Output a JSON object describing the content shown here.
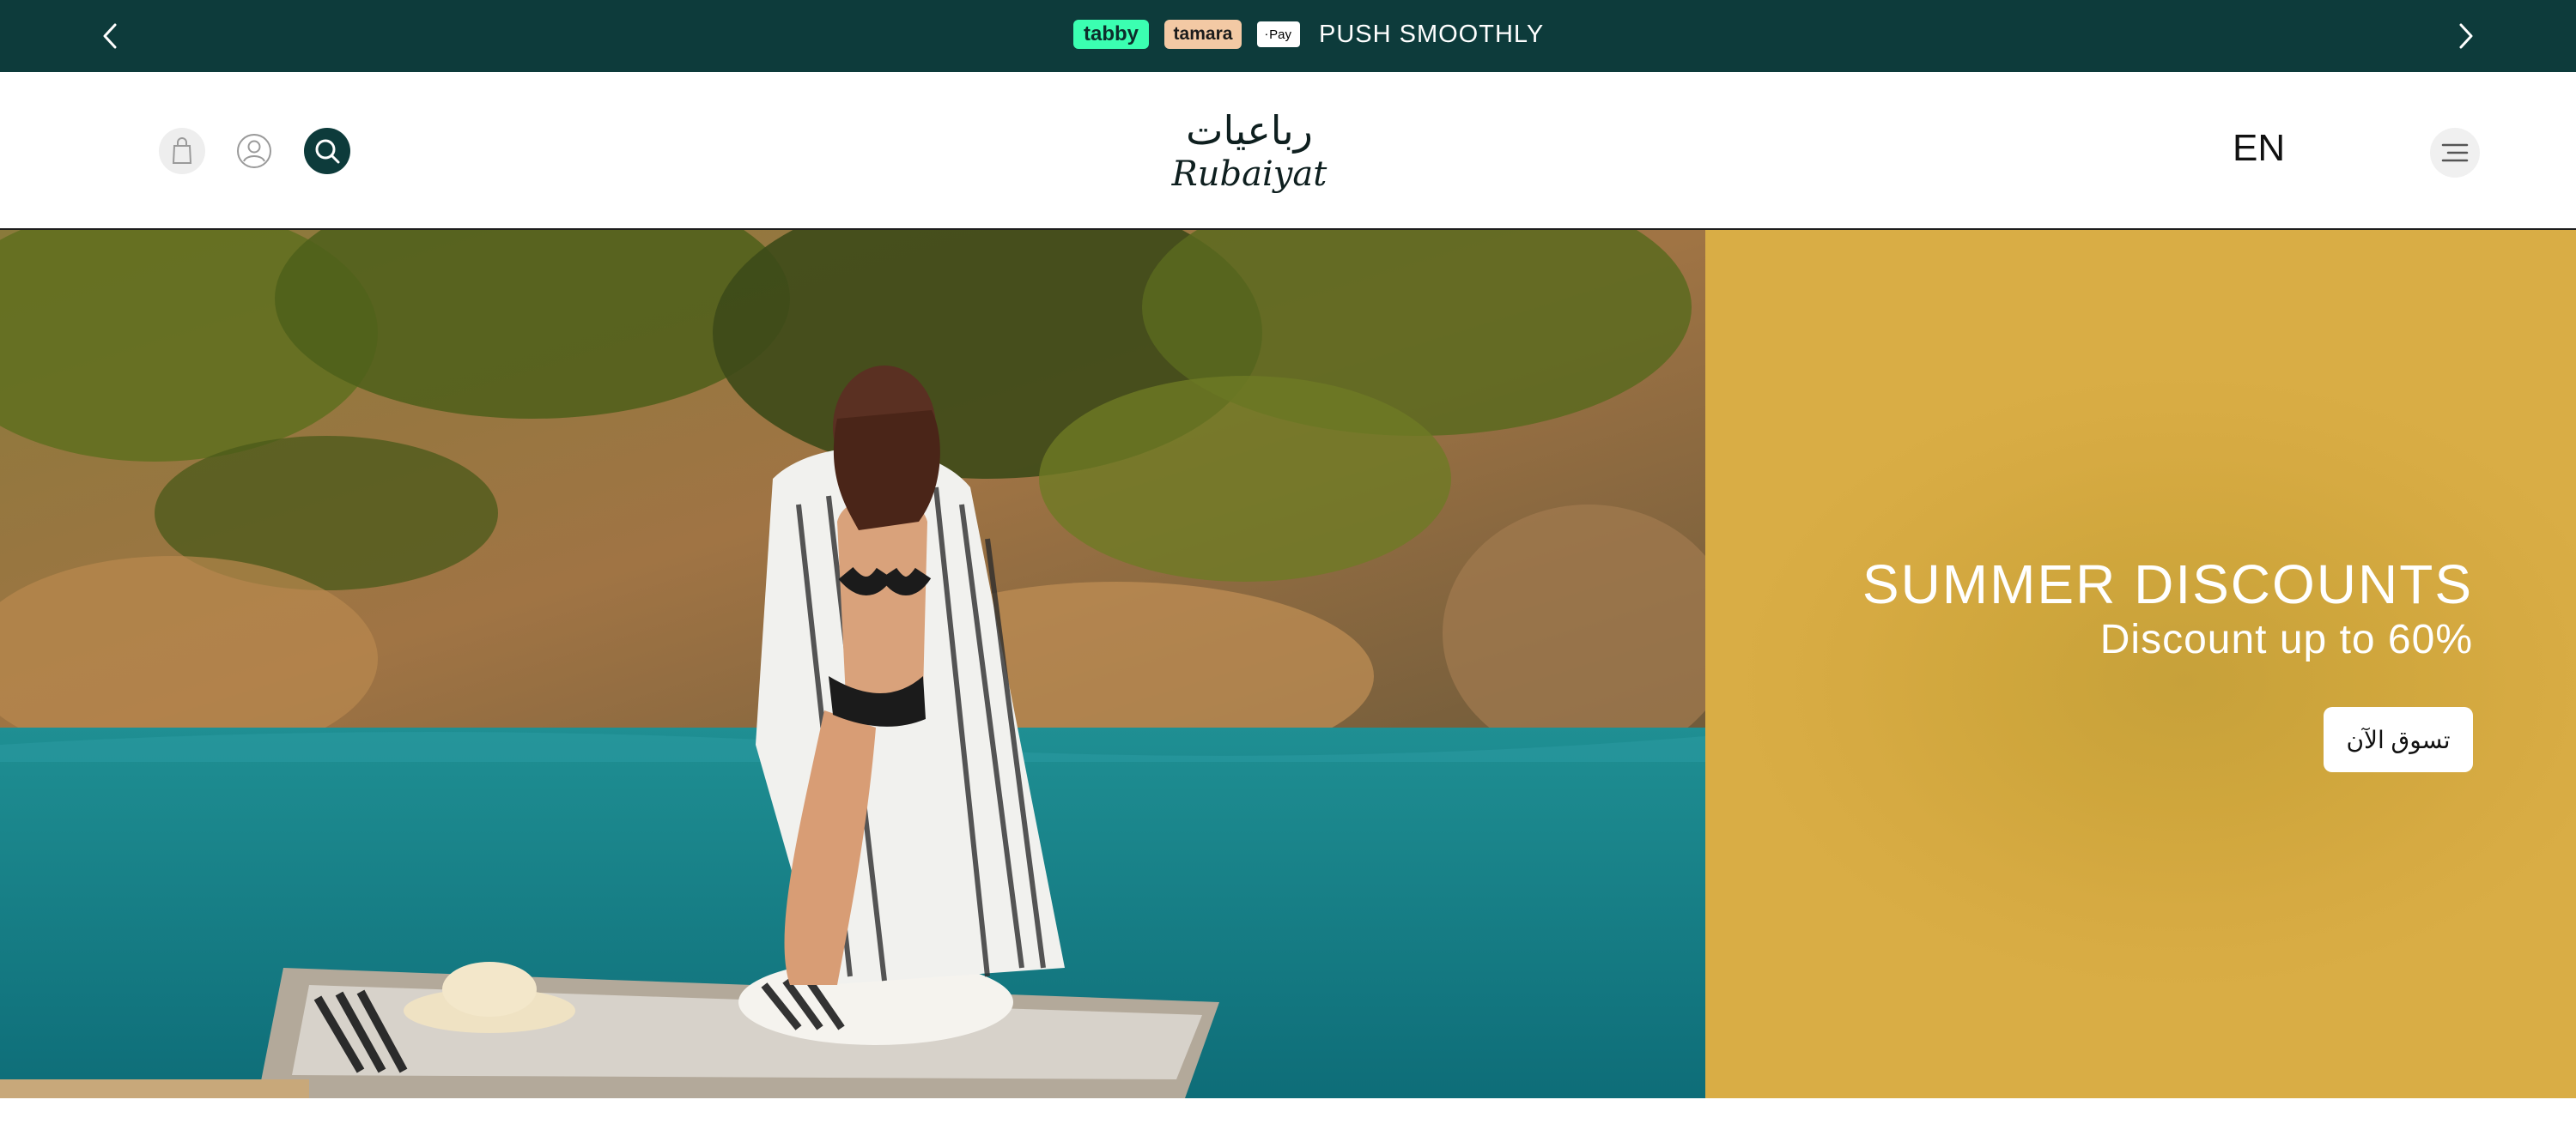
{
  "announcement": {
    "prev_icon": "chevron-left-icon",
    "next_icon": "chevron-right-icon",
    "badges": [
      "tabby",
      "tamara",
      "Pay"
    ],
    "text": "PUSH SMOOTHLY",
    "background": "#0d3b3b"
  },
  "header": {
    "icons": [
      "shopping-bag-icon",
      "user-icon",
      "search-icon",
      "menu-icon"
    ],
    "logo_arabic": "رباعيات",
    "logo_latin": "Rubaiyat",
    "language": "EN"
  },
  "hero": {
    "title": "SUMMER DISCOUNTS",
    "subtitle": "Discount up to 60%",
    "cta": "تسوق الآن",
    "panel_color": "#d6aa42"
  }
}
